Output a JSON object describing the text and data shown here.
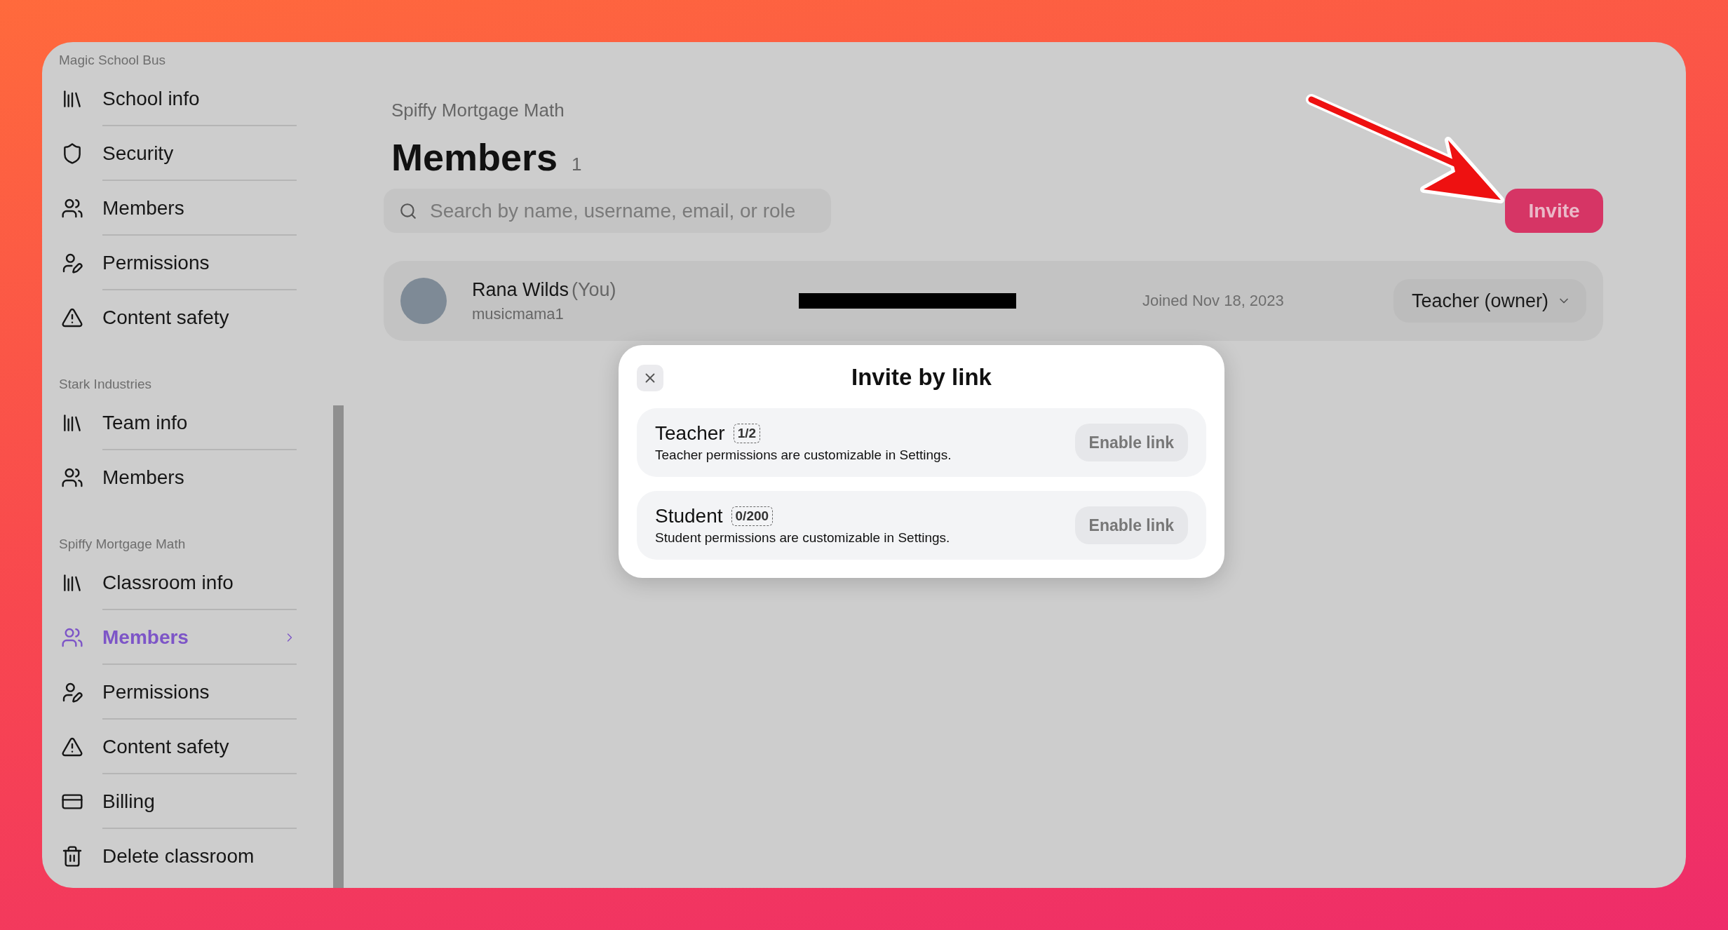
{
  "sidebar": {
    "groups": [
      {
        "label": "Magic School Bus",
        "items": [
          {
            "label": "School info",
            "kind": "info",
            "selected": false
          },
          {
            "label": "Security",
            "kind": "security",
            "selected": false
          },
          {
            "label": "Members",
            "kind": "members",
            "selected": false
          },
          {
            "label": "Permissions",
            "kind": "permissions",
            "selected": false
          },
          {
            "label": "Content safety",
            "kind": "safety",
            "selected": false
          }
        ]
      },
      {
        "label": "Stark Industries",
        "items": [
          {
            "label": "Team info",
            "kind": "info",
            "selected": false
          },
          {
            "label": "Members",
            "kind": "members",
            "selected": false
          }
        ]
      },
      {
        "label": "Spiffy Mortgage Math",
        "items": [
          {
            "label": "Classroom info",
            "kind": "info",
            "selected": false
          },
          {
            "label": "Members",
            "kind": "members",
            "selected": true
          },
          {
            "label": "Permissions",
            "kind": "permissions",
            "selected": false
          },
          {
            "label": "Content safety",
            "kind": "safety",
            "selected": false
          },
          {
            "label": "Billing",
            "kind": "billing",
            "selected": false
          },
          {
            "label": "Delete classroom",
            "kind": "delete",
            "selected": false
          }
        ]
      }
    ]
  },
  "header": {
    "breadcrumb": "Spiffy Mortgage Math",
    "title": "Members",
    "count": "1"
  },
  "search": {
    "placeholder": "Search by name, username, email, or role"
  },
  "invite_button": "Invite",
  "members": [
    {
      "name": "Rana Wilds",
      "you": "(You)",
      "username": "musicmama1",
      "joined": "Joined Nov 18, 2023",
      "role": "Teacher (owner)"
    }
  ],
  "modal": {
    "title": "Invite by link",
    "options": [
      {
        "title": "Teacher",
        "count": "1/2",
        "description": "Teacher permissions are customizable in Settings.",
        "button": "Enable link"
      },
      {
        "title": "Student",
        "count": "0/200",
        "description": "Student permissions are customizable in Settings.",
        "button": "Enable link"
      }
    ]
  }
}
